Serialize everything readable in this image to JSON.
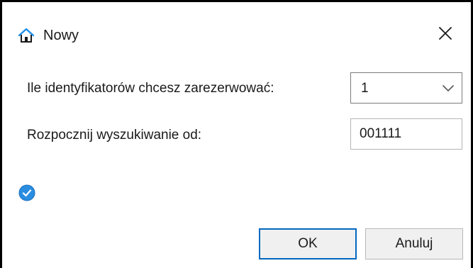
{
  "window": {
    "title": "Nowy",
    "title_icon": "home-icon",
    "close_icon": "close-icon"
  },
  "form": {
    "count_label": "Ile identyfikatorów chcesz zarezerwować:",
    "count_value": "1",
    "start_label": "Rozpocznij wyszukiwanie od:",
    "start_value": "001111"
  },
  "status": {
    "icon": "check-circle-icon",
    "color": "#2a8de0"
  },
  "buttons": {
    "ok_label": "OK",
    "cancel_label": "Anuluj"
  },
  "colors": {
    "accent": "#0067c0",
    "icon_blue": "#1e90e8"
  }
}
